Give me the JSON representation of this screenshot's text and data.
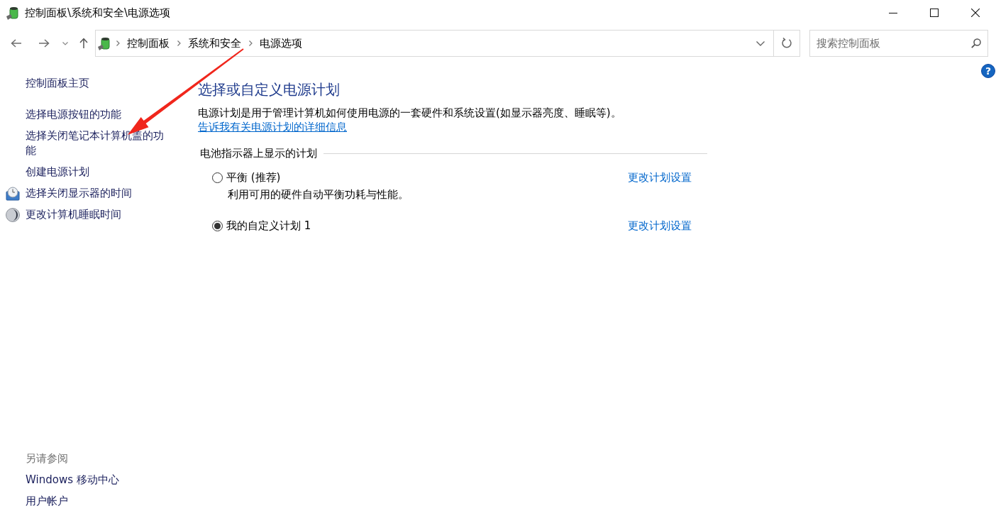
{
  "window": {
    "title": "控制面板\\系统和安全\\电源选项"
  },
  "address_bar": {
    "breadcrumbs": [
      "控制面板",
      "系统和安全",
      "电源选项"
    ]
  },
  "search": {
    "placeholder": "搜索控制面板"
  },
  "help_button": "?",
  "sidebar": {
    "home": "控制面板主页",
    "items": [
      {
        "label": "选择电源按钮的功能",
        "kind": "plain"
      },
      {
        "label": "选择关闭笔记本计算机盖的功能",
        "kind": "plain"
      },
      {
        "label": "创建电源计划",
        "kind": "plain"
      },
      {
        "label": "选择关闭显示器的时间",
        "kind": "display"
      },
      {
        "label": "更改计算机睡眠时间",
        "kind": "sleep"
      }
    ],
    "see_also": {
      "heading": "另请参阅",
      "links": [
        "Windows 移动中心",
        "用户帐户"
      ]
    }
  },
  "main": {
    "title": "选择或自定义电源计划",
    "description": "电源计划是用于管理计算机如何使用电源的一套硬件和系统设置(如显示器亮度、睡眠等)。",
    "description_link": "告诉我有关电源计划的详细信息",
    "section_heading": "电池指示器上显示的计划",
    "plans": [
      {
        "name": "平衡 (推荐)",
        "description": "利用可用的硬件自动平衡功耗与性能。",
        "selected": false,
        "link": "更改计划设置"
      },
      {
        "name": "我的自定义计划 1",
        "selected": true,
        "link": "更改计划设置"
      }
    ]
  }
}
